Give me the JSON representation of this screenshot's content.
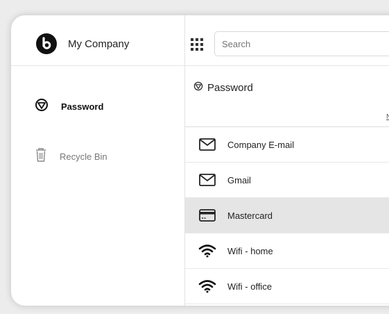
{
  "app": {
    "company_name": "My Company"
  },
  "search": {
    "placeholder": "Search"
  },
  "sidebar": {
    "items": [
      {
        "label": "Password",
        "icon": "shield-icon",
        "active": true
      },
      {
        "label": "Recycle Bin",
        "icon": "trash-icon",
        "active": false
      }
    ]
  },
  "main": {
    "title": "Password",
    "column_header_partial": "N",
    "entries": [
      {
        "name": "Company E-mail",
        "icon": "mail-icon",
        "selected": false
      },
      {
        "name": "Gmail",
        "icon": "mail-icon",
        "selected": false
      },
      {
        "name": "Mastercard",
        "icon": "credit-card-icon",
        "selected": true
      },
      {
        "name": "Wifi - home",
        "icon": "wifi-icon",
        "selected": false
      },
      {
        "name": "Wifi - office",
        "icon": "wifi-icon",
        "selected": false
      }
    ]
  }
}
